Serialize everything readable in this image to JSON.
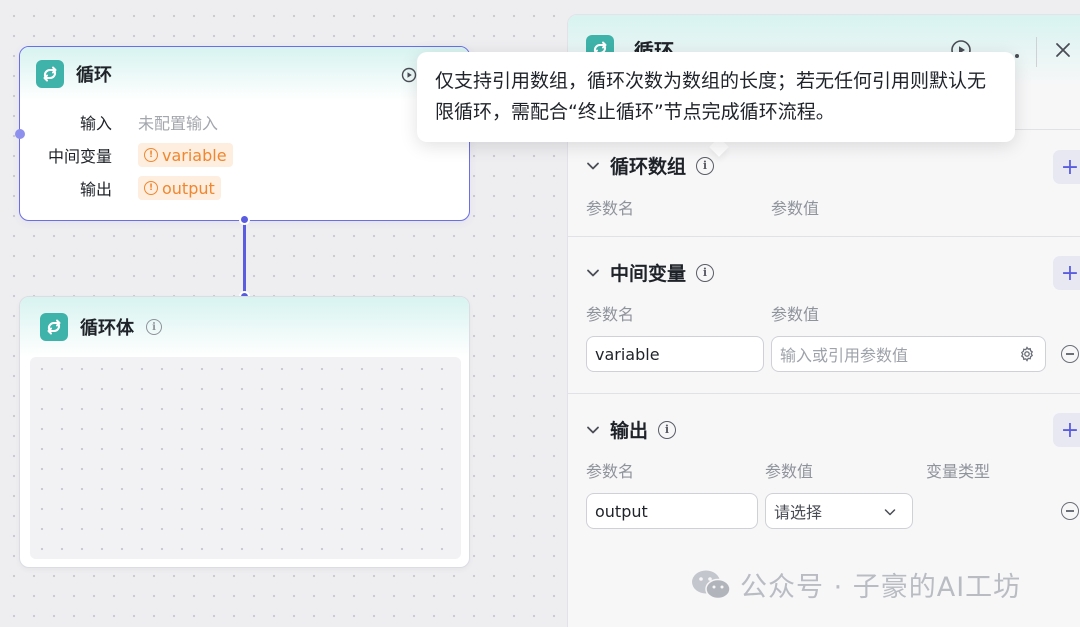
{
  "loop_node": {
    "title": "循环",
    "icon": "loop-icon",
    "rows": [
      {
        "label": "输入",
        "value": "未配置输入"
      },
      {
        "label": "中间变量",
        "value": "variable"
      },
      {
        "label": "输出",
        "value": "output"
      }
    ]
  },
  "loop_body_node": {
    "title": "循环体",
    "icon": "loop-icon"
  },
  "panel": {
    "title": "循环",
    "sections": {
      "loop_array": {
        "title": "循环数组",
        "col_name": "参数名",
        "col_value": "参数值"
      },
      "intermediate": {
        "title": "中间变量",
        "col_name": "参数名",
        "col_value": "参数值",
        "row": {
          "name": "variable",
          "value_placeholder": "输入或引用参数值"
        }
      },
      "output": {
        "title": "输出",
        "col_name": "参数名",
        "col_value": "参数值",
        "col_type": "变量类型",
        "row": {
          "name": "output",
          "select_value": "请选择"
        }
      }
    }
  },
  "tooltip": {
    "text": "仅支持引用数组，循环次数为数组的长度；若无任何引用则默认无限循环，需配合“终止循环”节点完成循环流程。"
  },
  "watermark": {
    "text": "公众号 · 子豪的AI工坊"
  },
  "colors": {
    "accent": "#5a5de0",
    "node_icon_bg": "#3fb3a9",
    "tag_orange": "#f0872f"
  }
}
